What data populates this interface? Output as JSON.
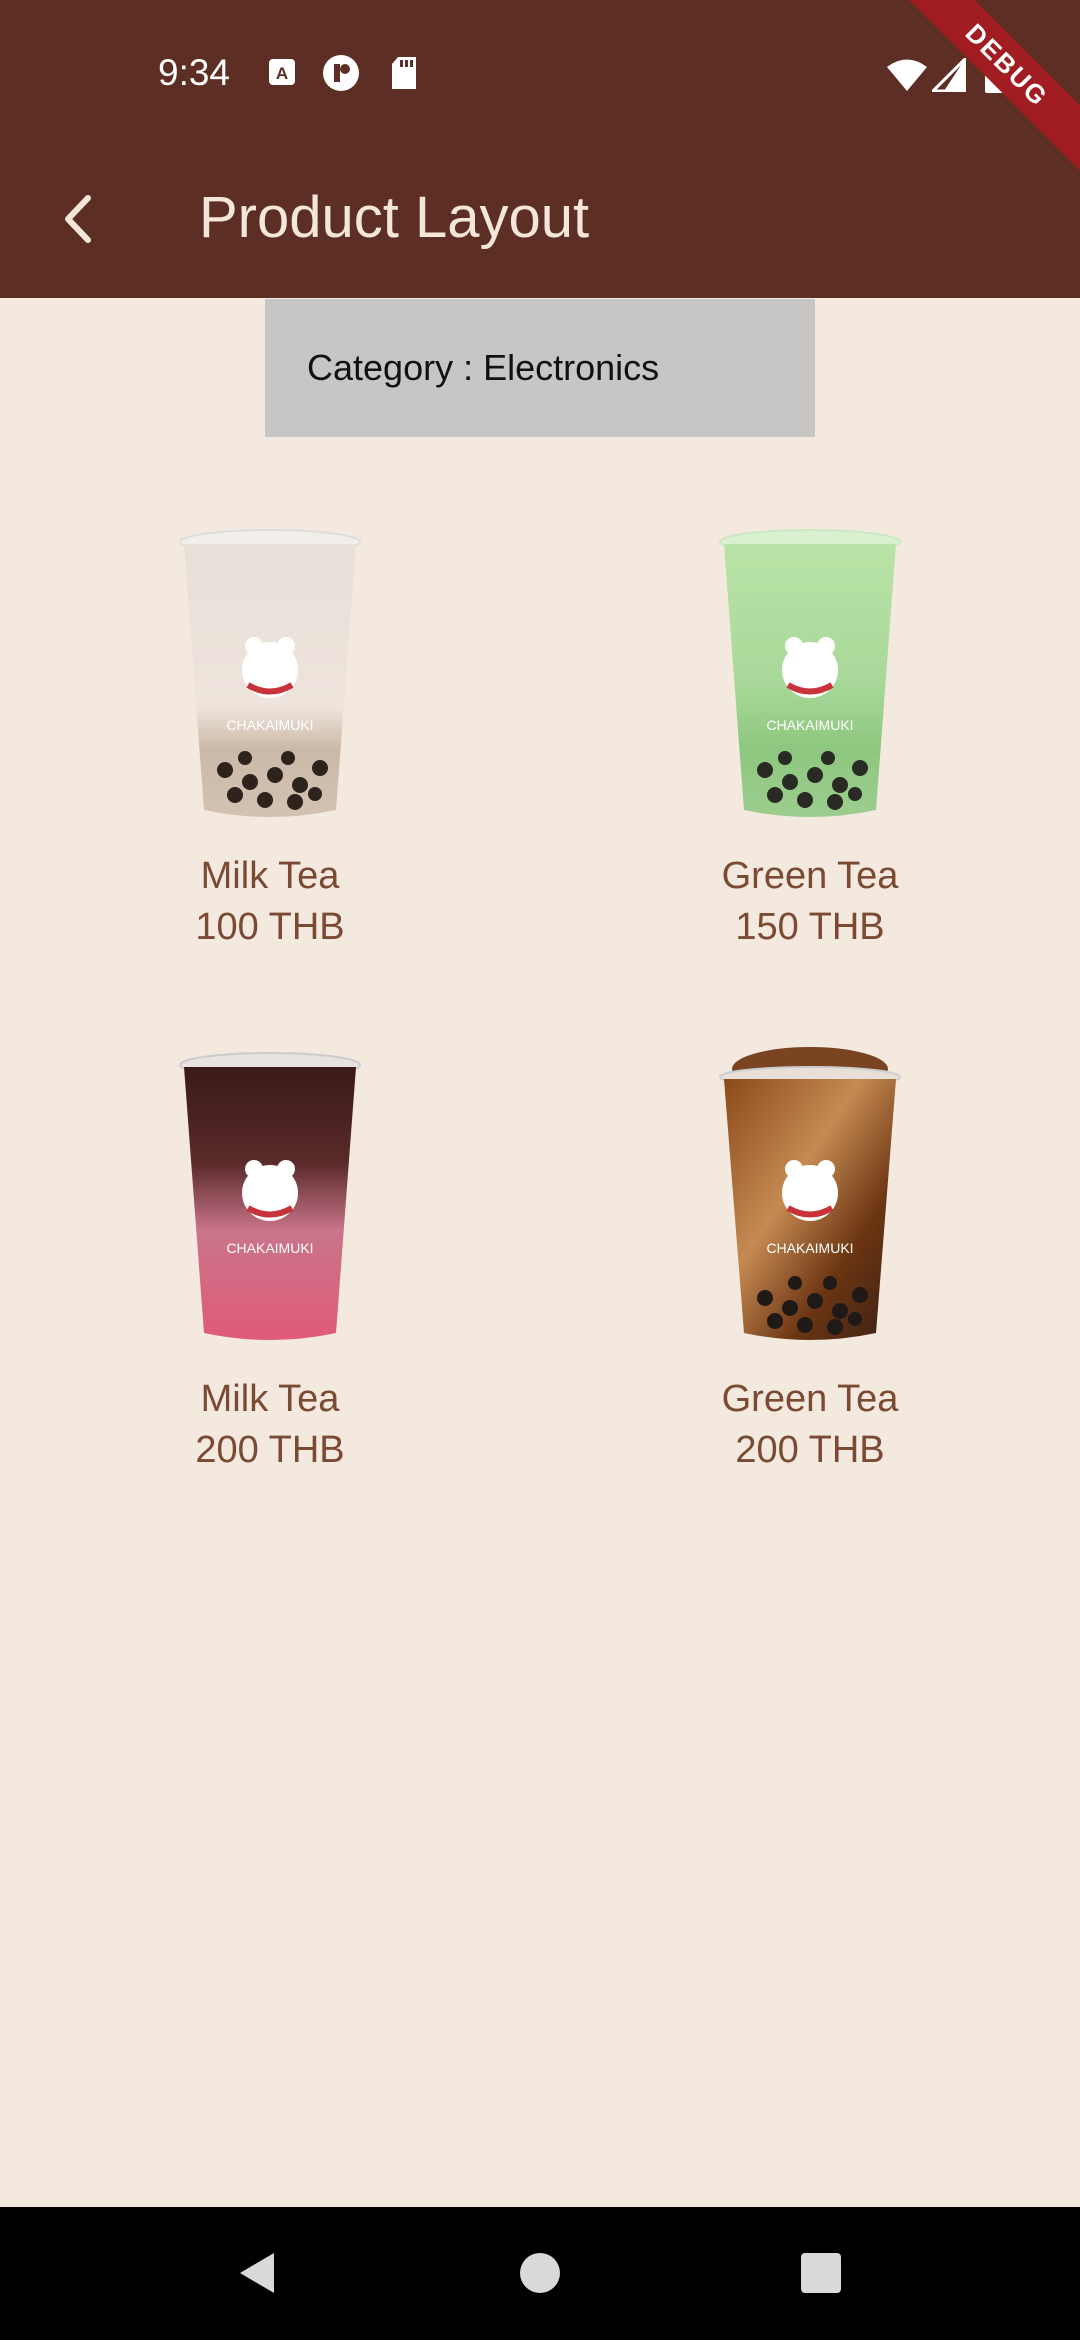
{
  "status_bar": {
    "time": "9:34",
    "left_icons": [
      "autofill-icon",
      "app-icon",
      "sd-card-icon"
    ],
    "right_icons": [
      "wifi-icon",
      "signal-icon",
      "battery-icon"
    ]
  },
  "debug_banner": "DEBUG",
  "toolbar": {
    "title": "Product Layout",
    "back_icon": "back-arrow-icon",
    "background": "#5d2e24",
    "foreground": "#f4e7da"
  },
  "category": {
    "label": "Category : Electronics"
  },
  "products": [
    {
      "name": "Milk Tea",
      "price": "100 THB",
      "image": "milk-tea-drink",
      "logo_text": "CHAKAIMUKI"
    },
    {
      "name": "Green Tea",
      "price": "150 THB",
      "image": "green-tea-drink",
      "logo_text": "CHAKAIMUKI"
    },
    {
      "name": "Milk Tea",
      "price": "200 THB",
      "image": "pink-milk-tea-drink",
      "logo_text": "CHAKAIMUKI"
    },
    {
      "name": "Green Tea",
      "price": "200 THB",
      "image": "brown-sugar-drink",
      "logo_text": "CHAKAIMUKI"
    }
  ],
  "nav_bar": {
    "buttons": [
      "back-triangle-icon",
      "home-circle-icon",
      "recents-square-icon"
    ]
  },
  "colors": {
    "page_background": "#f3e9df",
    "product_text": "#7a4a33",
    "category_background": "#c7c6c5"
  }
}
